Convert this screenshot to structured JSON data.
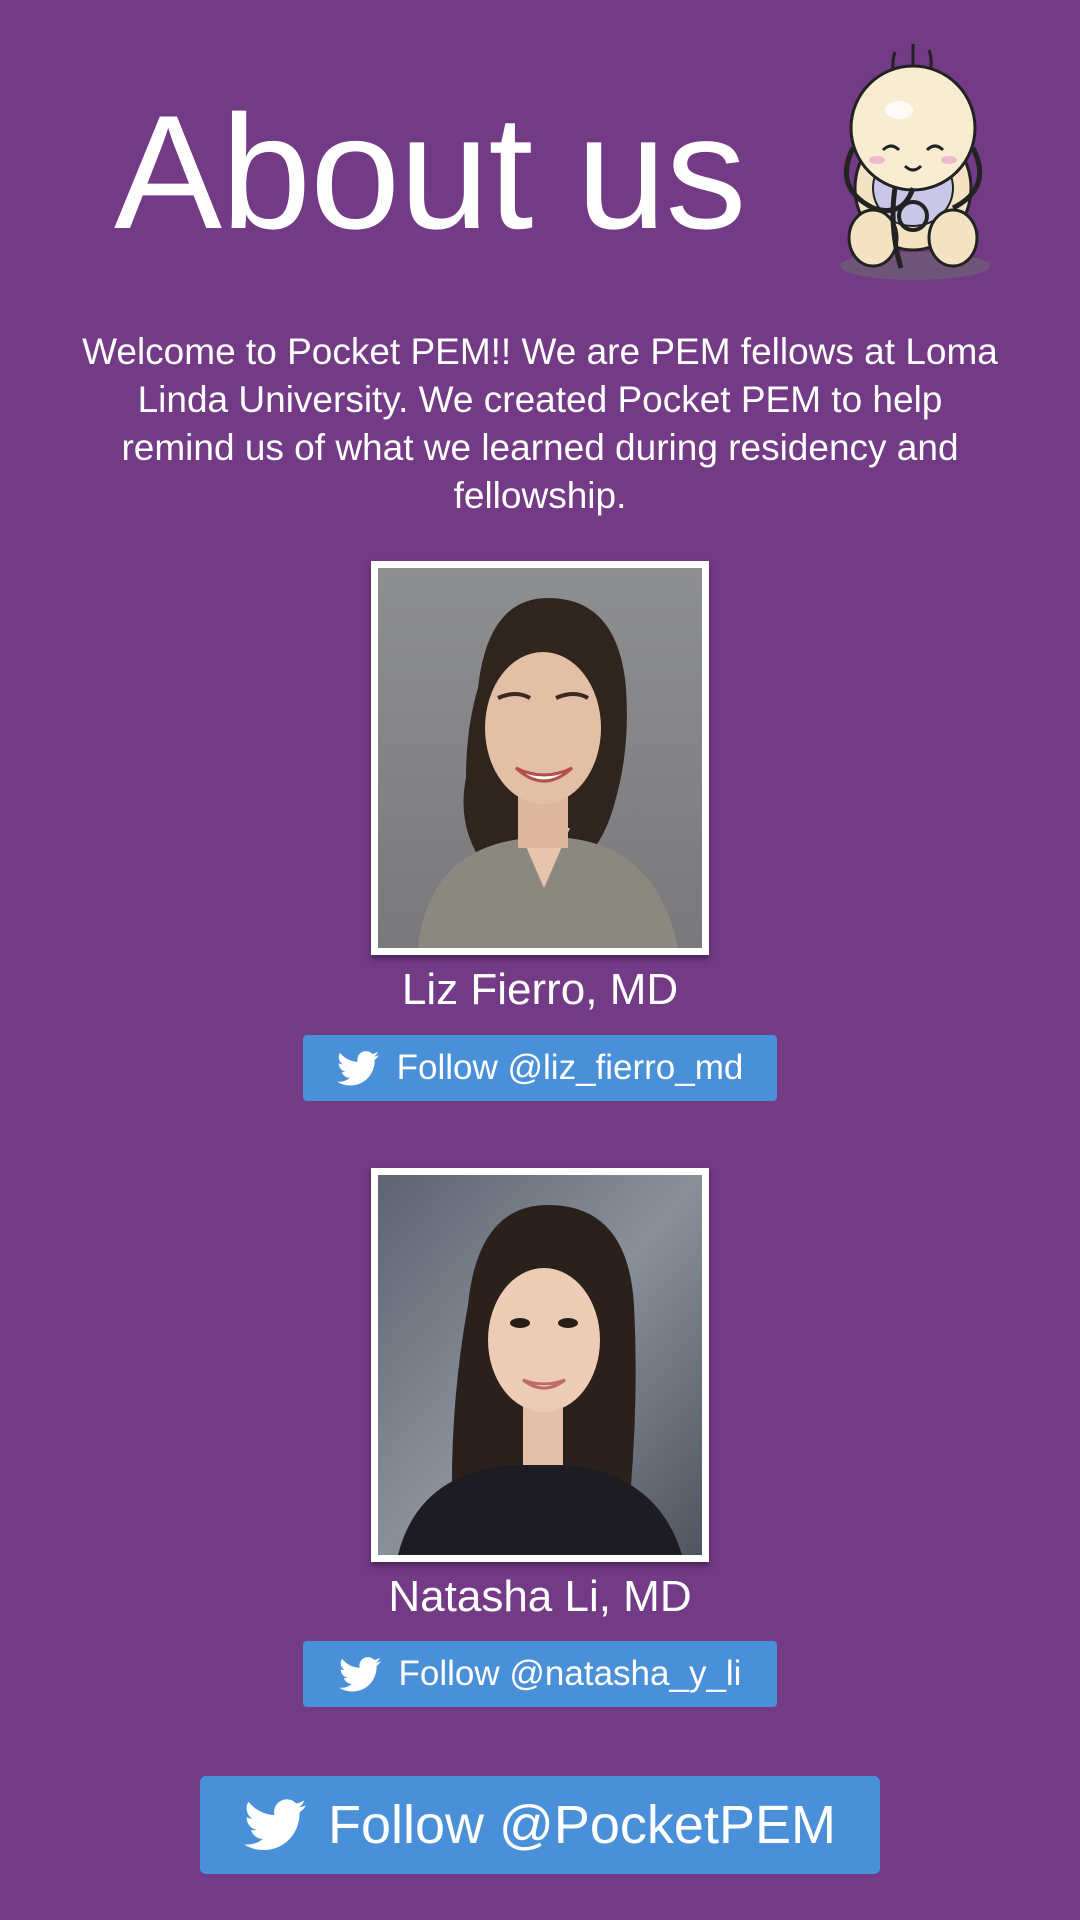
{
  "header": {
    "title": "About us",
    "mascot_icon": "baby-with-stethoscope-icon"
  },
  "intro": {
    "text": "Welcome to Pocket PEM!! We are PEM fellows at Loma Linda University.  We created Pocket PEM to help remind us of what we learned during residency and fellowship."
  },
  "people": [
    {
      "name": "Liz Fierro, MD",
      "follow_label": "Follow @liz_fierro_md",
      "photo": "portrait-photo"
    },
    {
      "name": "Natasha Li, MD",
      "follow_label": "Follow @natasha_y_li",
      "photo": "portrait-photo"
    }
  ],
  "main_follow": {
    "label": "Follow @PocketPEM",
    "icon": "twitter-bird-icon"
  },
  "colors": {
    "background": "#733a86",
    "button": "#4a90d9",
    "text": "#ffffff"
  }
}
